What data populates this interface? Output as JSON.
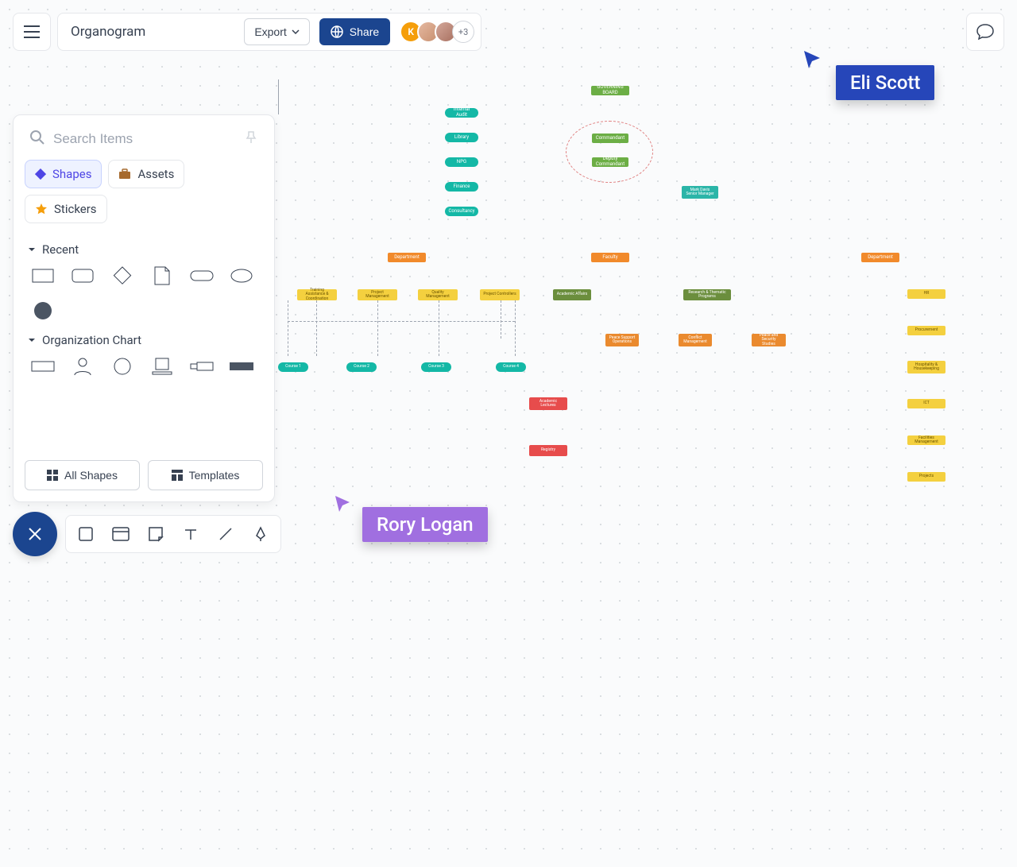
{
  "doc": {
    "title": "Organogram"
  },
  "toolbar": {
    "export": "Export",
    "share": "Share",
    "avatar_initial": "K",
    "avatar_more": "+3"
  },
  "panel": {
    "search_placeholder": "Search Items",
    "tabs": {
      "shapes": "Shapes",
      "assets": "Assets",
      "stickers": "Stickers"
    },
    "sections": {
      "recent": "Recent",
      "orgchart": "Organization Chart"
    },
    "footer": {
      "all_shapes": "All Shapes",
      "templates": "Templates"
    }
  },
  "cursors": {
    "eli": "Eli Scott",
    "rory": "Rory Logan"
  },
  "org": {
    "top": "GOVERNING BOARD",
    "commandant": "Commandant",
    "deputy": "Deputy Commandant",
    "assistant": "Mark Davis\nSenior Manager",
    "left_pills": [
      "Internal Audit",
      "Library",
      "NPG",
      "Finance",
      "Consultancy"
    ],
    "dept_l": "Department",
    "dept_r": "Department",
    "faculty": "Faculty",
    "yellow_l": [
      "Training Assistance & Coordination",
      "Project Management",
      "Quality Management",
      "Project Controllers"
    ],
    "olive": [
      "Academic Affairs",
      "Research & Thematic Programs"
    ],
    "orange_r": [
      "Peace Support Operations",
      "Conflict Management",
      "Peace and Security Studies"
    ],
    "courses": [
      "Course 1",
      "Course 2",
      "Course 3",
      "Course 4"
    ],
    "red": [
      "Academic Lectures",
      "Registry"
    ],
    "right_col": [
      "HR",
      "Procurement",
      "Hospitality & Housekeeping",
      "ICT",
      "Facilities Management",
      "Projects"
    ]
  }
}
